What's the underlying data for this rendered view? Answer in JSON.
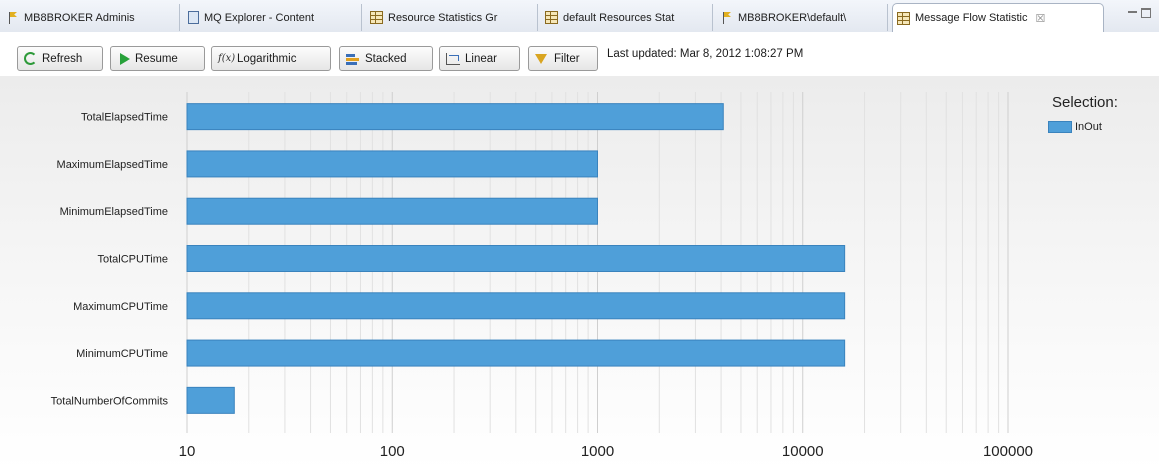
{
  "tabs": [
    {
      "label": "MB8BROKER  Adminis",
      "icon": "flag-icon"
    },
    {
      "label": "MQ Explorer - Content",
      "icon": "document-icon"
    },
    {
      "label": "Resource Statistics Gr",
      "icon": "table-icon"
    },
    {
      "label": "default Resources Stat",
      "icon": "table-icon"
    },
    {
      "label": "MB8BROKER\\default\\",
      "icon": "flag-icon"
    },
    {
      "label": "Message Flow Statistic",
      "icon": "table-icon",
      "active": true,
      "close": "☒"
    }
  ],
  "toolbar": {
    "refresh_label": "Refresh",
    "resume_label": "Resume",
    "logarithmic_label": "Logarithmic",
    "stacked_label": "Stacked",
    "linear_label": "Linear",
    "filter_label": "Filter",
    "last_updated": "Last updated: Mar 8, 2012 1:08:27 PM"
  },
  "legend": {
    "title": "Selection:",
    "items": [
      {
        "name": "InOut",
        "color": "#4f9fd9"
      }
    ]
  },
  "chart_data": {
    "type": "bar",
    "orientation": "horizontal",
    "x_scale": "log",
    "xlim": [
      10,
      100000
    ],
    "x_ticks": [
      "10",
      "100",
      "1000",
      "10000",
      "100000"
    ],
    "grid": true,
    "legend_position": "top-right",
    "categories": [
      "TotalElapsedTime",
      "MaximumElapsedTime",
      "MinimumElapsedTime",
      "TotalCPUTime",
      "MaximumCPUTime",
      "MinimumCPUTime",
      "TotalNumberOfCommits"
    ],
    "series": [
      {
        "name": "InOut",
        "color": "#4f9fd9",
        "values": [
          4100,
          1000,
          1000,
          16000,
          16000,
          16000,
          17
        ]
      }
    ]
  }
}
